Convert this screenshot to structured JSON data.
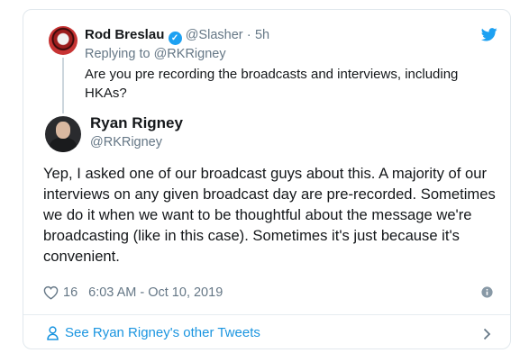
{
  "reply_tweet": {
    "author_name": "Rod Breslau",
    "handle": "@Slasher",
    "separator": "·",
    "time": "5h",
    "replying_prefix": "Replying to",
    "replying_to": "@RKRigney",
    "text": "Are you pre recording the broadcasts and interviews, including HKAs?"
  },
  "main_tweet": {
    "author_name": "Ryan Rigney",
    "handle": "@RKRigney",
    "text": "Yep, I asked one of our broadcast guys about this. A majority of our interviews on any given broadcast day are pre-recorded. Sometimes we do it when we want to be thoughtful about the message we're broadcasting (like in this case). Sometimes it's just because it's convenient.",
    "likes": "16",
    "timestamp": "6:03 AM - Oct 10, 2019"
  },
  "footer": {
    "link_text": "See Ryan Rigney's other Tweets"
  },
  "colors": {
    "twitter_blue": "#1da1f2",
    "text": "#14171a",
    "muted": "#657786",
    "link": "#1b95e0"
  },
  "icons": {
    "brand": "twitter-bird-icon",
    "verified": "verified-badge-icon",
    "like": "heart-icon",
    "info": "info-icon",
    "profile": "person-icon",
    "chevron": "chevron-right-icon"
  }
}
